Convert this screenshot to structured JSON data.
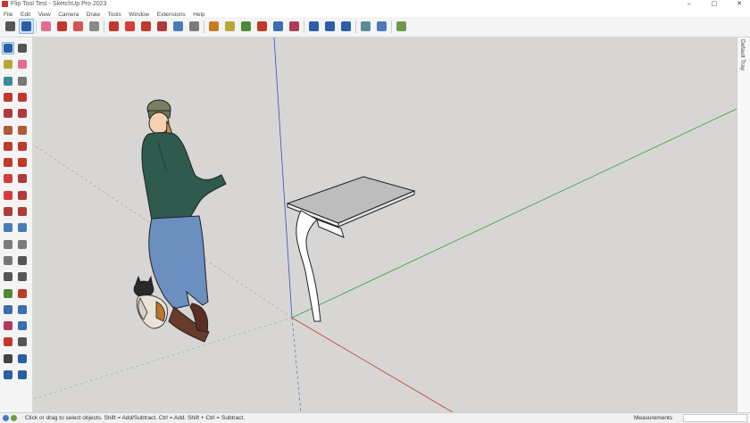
{
  "window": {
    "title": "Flip Tool Test - SketchUp Pro 2023",
    "controls": [
      "–",
      "▢",
      "✕"
    ]
  },
  "menu": [
    "File",
    "Edit",
    "View",
    "Camera",
    "Draw",
    "Tools",
    "Window",
    "Extensions",
    "Help"
  ],
  "toolbar": {
    "tools": [
      {
        "name": "search-tool",
        "color": "#555555"
      },
      {
        "name": "select-tool",
        "color": "#2c5ea8",
        "selected": true
      },
      {
        "name": "eraser-tool",
        "color": "#e26d8e"
      },
      {
        "name": "line-tool",
        "color": "#c0392b"
      },
      {
        "name": "arc-tool",
        "color": "#d35454"
      },
      {
        "name": "shape-tool",
        "color": "#8a8a8a"
      },
      {
        "name": "pushpull-tool",
        "color": "#c0392b"
      },
      {
        "name": "move-tool",
        "color": "#d43b3b"
      },
      {
        "name": "rotate-tool",
        "color": "#c0392b"
      },
      {
        "name": "scale-tool",
        "color": "#b03a3a"
      },
      {
        "name": "offset-tool",
        "color": "#4a7ab8"
      },
      {
        "name": "tape-tool",
        "color": "#7a7a7a"
      },
      {
        "name": "text-tool",
        "color": "#c77c1e"
      },
      {
        "name": "paint-tool",
        "color": "#b8a638"
      },
      {
        "name": "orbit-tool",
        "color": "#4d8a3a"
      },
      {
        "name": "pan-tool",
        "color": "#c0392b"
      },
      {
        "name": "zoom-tool",
        "color": "#3b6db0"
      },
      {
        "name": "zoom-extents-tool",
        "color": "#b03a5a"
      },
      {
        "name": "warehouse-tool",
        "color": "#2c5ea8"
      },
      {
        "name": "extension-warehouse-tool",
        "color": "#2c5ea8"
      },
      {
        "name": "layout-tool",
        "color": "#2c5ea8"
      },
      {
        "name": "model-info-tool",
        "color": "#5a8a9a"
      },
      {
        "name": "styles-tool",
        "color": "#4a7ab8"
      },
      {
        "name": "geo-tool",
        "color": "#6a9a4a"
      }
    ]
  },
  "left_toolbar": {
    "tools": [
      {
        "name": "select",
        "color": "#2c5ea8",
        "selected": true
      },
      {
        "name": "lasso",
        "color": "#555555"
      },
      {
        "name": "paint",
        "color": "#b8a638"
      },
      {
        "name": "eraser",
        "color": "#e26d8e"
      },
      {
        "name": "components",
        "color": "#3a8a9a"
      },
      {
        "name": "tag",
        "color": "#777777"
      },
      {
        "name": "line",
        "color": "#c0392b"
      },
      {
        "name": "freehand",
        "color": "#c0392b"
      },
      {
        "name": "rectangle",
        "color": "#b03a3a"
      },
      {
        "name": "rotated-rect",
        "color": "#b03a3a"
      },
      {
        "name": "circle",
        "color": "#b05a3a"
      },
      {
        "name": "polygon",
        "color": "#b05a3a"
      },
      {
        "name": "arc",
        "color": "#c0392b"
      },
      {
        "name": "arc-2",
        "color": "#c0392b"
      },
      {
        "name": "arc-3",
        "color": "#c0392b"
      },
      {
        "name": "pie",
        "color": "#c0392b"
      },
      {
        "name": "move",
        "color": "#d43b3b"
      },
      {
        "name": "pushpull",
        "color": "#b03a3a"
      },
      {
        "name": "rotate",
        "color": "#d43b3b"
      },
      {
        "name": "followme",
        "color": "#b03a3a"
      },
      {
        "name": "scale",
        "color": "#b03a3a"
      },
      {
        "name": "offset",
        "color": "#b03a3a"
      },
      {
        "name": "flip",
        "color": "#4a7ab8"
      },
      {
        "name": "flip-2",
        "color": "#4a7ab8"
      },
      {
        "name": "tape",
        "color": "#7a7a7a"
      },
      {
        "name": "dimension",
        "color": "#7a7a7a"
      },
      {
        "name": "protractor",
        "color": "#777777"
      },
      {
        "name": "text",
        "color": "#555555"
      },
      {
        "name": "axes",
        "color": "#555555"
      },
      {
        "name": "3dtext",
        "color": "#555555"
      },
      {
        "name": "orbit",
        "color": "#4d8a3a"
      },
      {
        "name": "pan",
        "color": "#c0392b"
      },
      {
        "name": "zoom",
        "color": "#3b6db0"
      },
      {
        "name": "zoom-window",
        "color": "#3b6db0"
      },
      {
        "name": "zoom-extents",
        "color": "#b03a5a"
      },
      {
        "name": "previous",
        "color": "#3b6db0"
      },
      {
        "name": "position-camera",
        "color": "#c0392b"
      },
      {
        "name": "look-around",
        "color": "#555555"
      },
      {
        "name": "walk",
        "color": "#444444"
      },
      {
        "name": "section",
        "color": "#2c5ea8"
      },
      {
        "name": "section-2",
        "color": "#2c5ea8"
      },
      {
        "name": "section-3",
        "color": "#2c5ea8"
      }
    ]
  },
  "tray": {
    "label": "Default Tray"
  },
  "status": {
    "hint": "Click or drag to select objects. Shift = Add/Subtract. Ctrl = Add. Shift + Ctrl = Subtract.",
    "measurements_label": "Measurements",
    "measurements_value": ""
  },
  "colors": {
    "viewport_bg": "#d7d6d5",
    "axis_blue": "#3b4dbf",
    "axis_green": "#3aa03a",
    "axis_red": "#c0392b",
    "shirt": "#2f5a4e",
    "jeans": "#6b8fbf",
    "hat": "#7a7f5f",
    "hair": "#c9923c",
    "skin": "#f5d1b2"
  }
}
